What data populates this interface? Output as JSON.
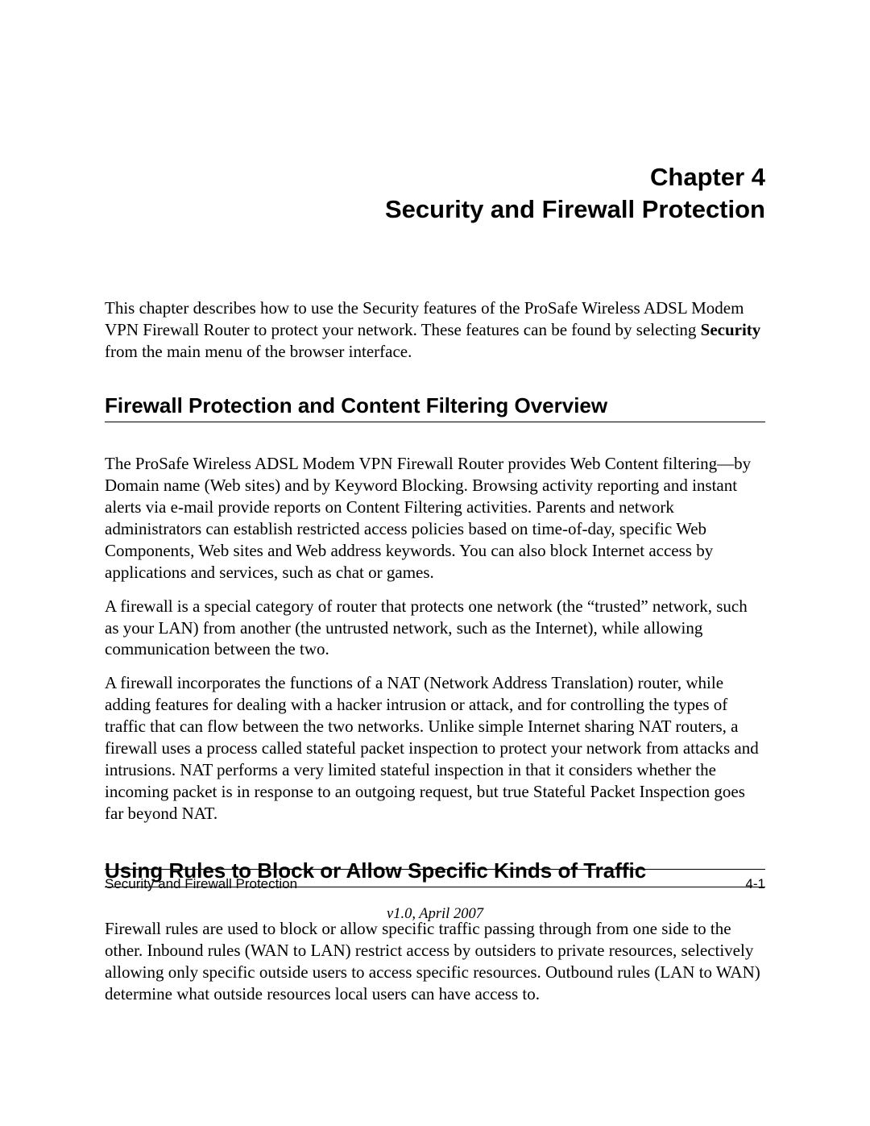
{
  "chapter": {
    "number": "Chapter 4",
    "title": "Security and Firewall Protection"
  },
  "intro": {
    "part1": "This chapter describes how to use the Security features of the ProSafe Wireless ADSL Modem VPN Firewall Router to protect your network. These features can be found by selecting ",
    "bold": "Security",
    "part2": " from the main menu of the browser interface."
  },
  "sections": {
    "s1": {
      "heading": "Firewall Protection and Content Filtering Overview",
      "p1": "The ProSafe Wireless ADSL Modem VPN Firewall Router provides Web Content filtering—by Domain name (Web sites) and by Keyword Blocking. Browsing activity reporting and instant alerts via e-mail provide reports on Content Filtering activities. Parents and network administrators can establish restricted access policies based on time-of-day, specific Web Components, Web sites and Web address keywords. You can also block Internet access by applications and services, such as chat or games.",
      "p2": "A firewall is a special category of router that protects one network (the “trusted” network, such as your LAN) from another (the untrusted network, such as the Internet), while allowing communication between the two.",
      "p3": "A firewall incorporates the functions of a NAT (Network Address Translation) router, while adding features for dealing with a hacker intrusion or attack, and for controlling the types of traffic that can flow between the two networks. Unlike simple Internet sharing NAT routers, a firewall uses a process called stateful packet inspection to protect your network from attacks and intrusions. NAT performs a very limited stateful inspection in that it considers whether the incoming packet is in response to an outgoing request, but true Stateful Packet Inspection goes far beyond NAT."
    },
    "s2": {
      "heading": "Using Rules to Block or Allow Specific Kinds of Traffic",
      "p1": "Firewall rules are used to block or allow specific traffic passing through from one side to the other. Inbound rules (WAN to LAN) restrict access by outsiders to private resources, selectively allowing only specific outside users to access specific resources. Outbound rules (LAN to WAN) determine what outside resources local users can have access to."
    }
  },
  "footer": {
    "left": "Security and Firewall Protection",
    "right": "4-1",
    "version": "v1.0, April 2007"
  }
}
